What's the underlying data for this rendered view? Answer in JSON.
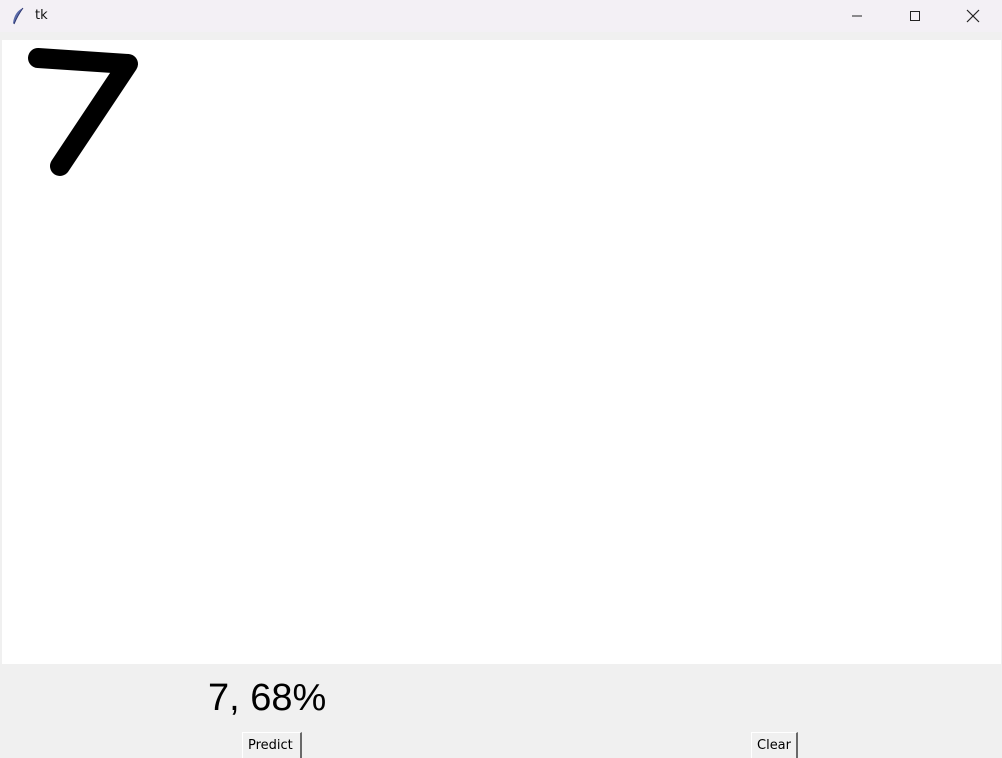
{
  "window": {
    "title": "tk",
    "controls": {
      "minimize_icon": "minimize-icon",
      "maximize_icon": "maximize-icon",
      "close_icon": "close-icon"
    },
    "app_icon": "feather-icon"
  },
  "canvas": {
    "background": "#ffffff",
    "stroke_color": "#000000",
    "drawn_content": "handwritten digit 7"
  },
  "result": {
    "text": "7, 68%"
  },
  "buttons": {
    "predict_label": "Predict",
    "clear_label": "Clear"
  }
}
